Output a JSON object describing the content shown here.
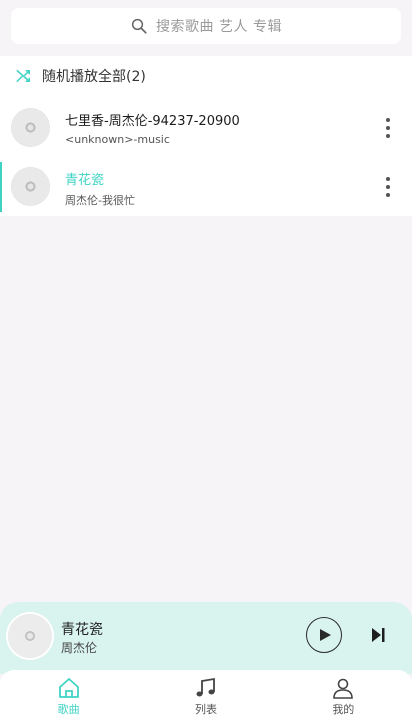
{
  "search": {
    "placeholder": "搜索歌曲 艺人 专辑"
  },
  "list": {
    "shuffle_label": "随机播放全部(2)",
    "songs": [
      {
        "title": "七里香-周杰伦-94237-20900",
        "subtitle": "<unknown>-music",
        "active": false
      },
      {
        "title": "青花瓷",
        "subtitle": "周杰伦-我很忙",
        "active": true
      }
    ]
  },
  "player": {
    "title": "青花瓷",
    "artist": "周杰伦"
  },
  "tabs": [
    {
      "label": "歌曲",
      "icon": "home-icon",
      "active": true
    },
    {
      "label": "列表",
      "icon": "music-note-icon",
      "active": false
    },
    {
      "label": "我的",
      "icon": "person-icon",
      "active": false
    }
  ],
  "colors": {
    "accent": "#3fd3c4",
    "player_bg": "#d9f3ee",
    "page_bg": "#f7f4f7"
  }
}
